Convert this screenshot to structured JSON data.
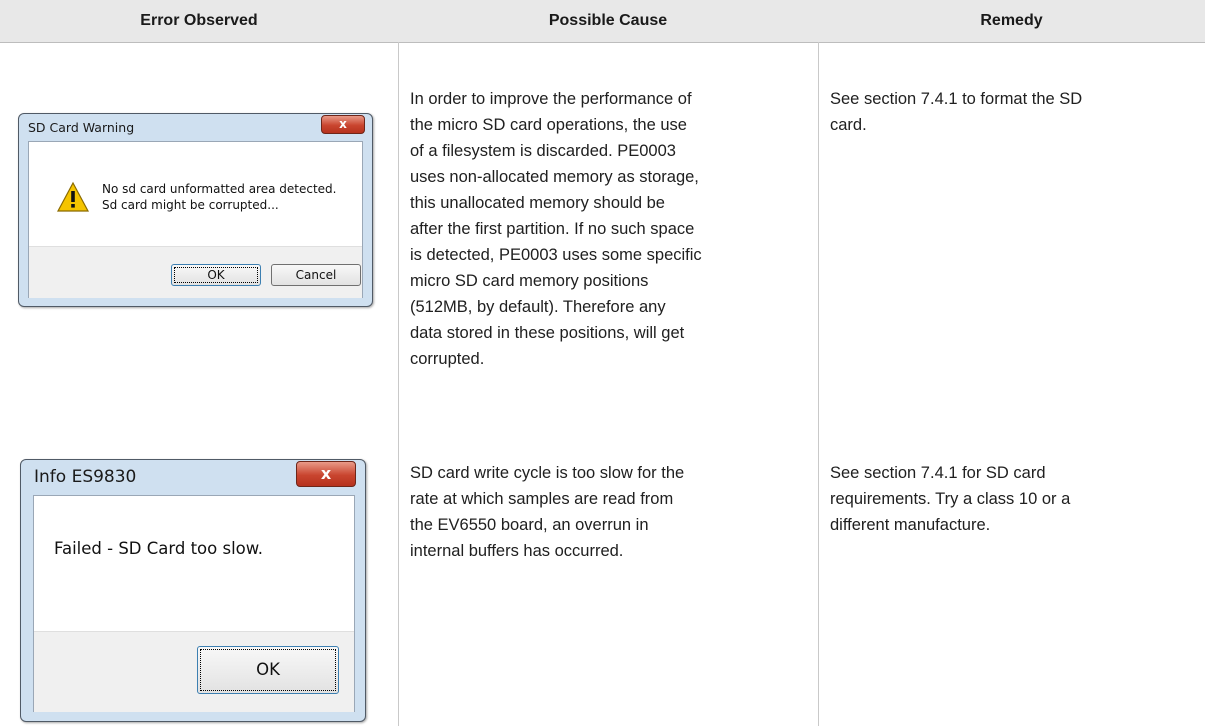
{
  "headers": {
    "error": "Error Observed",
    "cause": "Possible Cause",
    "remedy": "Remedy"
  },
  "row1": {
    "dialog": {
      "title": "SD Card Warning",
      "close_glyph": "x",
      "message_line1": "No sd card unformatted area detected.",
      "message_line2": "Sd card might be corrupted...",
      "icon": "warning-icon",
      "ok_label": "OK",
      "cancel_label": "Cancel"
    },
    "cause_lines": [
      "In order to improve the performance of",
      "the micro SD card operations, the use",
      "of a filesystem is discarded. PE0003",
      "uses non-allocated memory as storage,",
      "this unallocated memory should be",
      "after the first partition. If no such space",
      "is detected, PE0003 uses some specific",
      "micro SD card memory positions",
      "(512MB, by default). Therefore any",
      "data stored in these positions, will get",
      "corrupted."
    ],
    "remedy_lines": [
      "See section 7.4.1 to format the SD",
      "card."
    ]
  },
  "row2": {
    "dialog": {
      "title": "Info ES9830",
      "close_glyph": "x",
      "message": "Failed - SD Card too slow.",
      "ok_label": "OK"
    },
    "cause_lines": [
      "SD card write cycle is too slow for the",
      "rate at which samples are read from",
      "the EV6550 board, an overrun in",
      "internal buffers has occurred."
    ],
    "remedy_lines": [
      "See section 7.4.1 for SD card",
      "requirements. Try a class 10 or a",
      "different manufacture."
    ]
  }
}
